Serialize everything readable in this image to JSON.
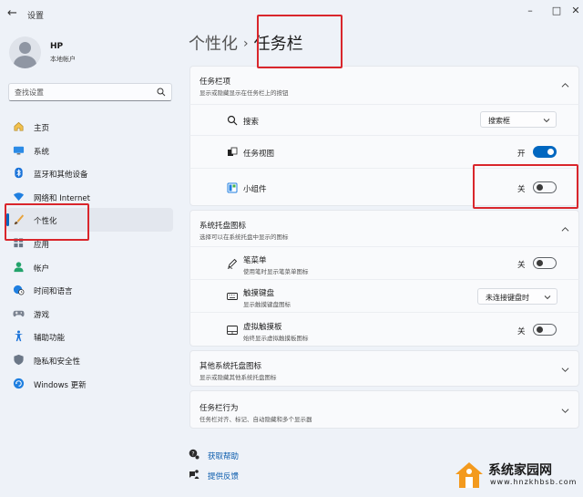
{
  "window": {
    "title": "设置"
  },
  "profile": {
    "name": "HP",
    "account_type": "本地帐户"
  },
  "search": {
    "placeholder": "查找设置"
  },
  "sidebar": {
    "items": [
      {
        "label": "主页",
        "icon": "home-icon"
      },
      {
        "label": "系统",
        "icon": "monitor-icon"
      },
      {
        "label": "蓝牙和其他设备",
        "icon": "bluetooth-icon"
      },
      {
        "label": "网络和 Internet",
        "icon": "wifi-icon"
      },
      {
        "label": "个性化",
        "icon": "brush-icon",
        "active": true
      },
      {
        "label": "应用",
        "icon": "apps-icon"
      },
      {
        "label": "帐户",
        "icon": "person-icon"
      },
      {
        "label": "时间和语言",
        "icon": "globe-clock-icon"
      },
      {
        "label": "游戏",
        "icon": "gamepad-icon"
      },
      {
        "label": "辅助功能",
        "icon": "accessibility-icon"
      },
      {
        "label": "隐私和安全性",
        "icon": "shield-icon"
      },
      {
        "label": "Windows 更新",
        "icon": "update-icon"
      }
    ]
  },
  "breadcrumb": {
    "parent": "个性化",
    "separator": "›",
    "current": "任务栏"
  },
  "taskbar_items": {
    "title": "任务栏项",
    "subtitle": "显示或隐藏显示在任务栏上的按钮",
    "rows": [
      {
        "label": "搜索",
        "icon": "search-icon",
        "control": "dropdown",
        "value": "搜索框"
      },
      {
        "label": "任务视图",
        "icon": "task-view-icon",
        "control": "toggle",
        "state": "开",
        "on": true
      },
      {
        "label": "小组件",
        "icon": "widgets-icon",
        "control": "toggle",
        "state": "关",
        "on": false
      }
    ]
  },
  "tray_icons": {
    "title": "系统托盘图标",
    "subtitle": "选择可以在系统托盘中显示的图标",
    "rows": [
      {
        "label": "笔菜单",
        "sub": "使用笔时显示笔菜单图标",
        "icon": "pen-icon",
        "control": "toggle",
        "state": "关",
        "on": false
      },
      {
        "label": "触摸键盘",
        "sub": "显示触摸键盘图标",
        "icon": "keyboard-icon",
        "control": "dropdown",
        "value": "未连接键盘时"
      },
      {
        "label": "虚拟触摸板",
        "sub": "始终显示虚拟触摸板图标",
        "icon": "touchpad-icon",
        "control": "toggle",
        "state": "关",
        "on": false
      }
    ]
  },
  "other_tray": {
    "title": "其他系统托盘图标",
    "subtitle": "显示或隐藏其他系统托盘图标"
  },
  "taskbar_behavior": {
    "title": "任务栏行为",
    "subtitle": "任务栏对齐、标记、自动隐藏和多个显示器"
  },
  "footer": {
    "help": "获取帮助",
    "feedback": "提供反馈"
  },
  "watermark": {
    "name": "系统家园网",
    "url": "www.hnzkhbsb.com"
  },
  "colors": {
    "accent": "#0067c0",
    "highlight": "#d9262c",
    "background": "#eef2f8"
  }
}
